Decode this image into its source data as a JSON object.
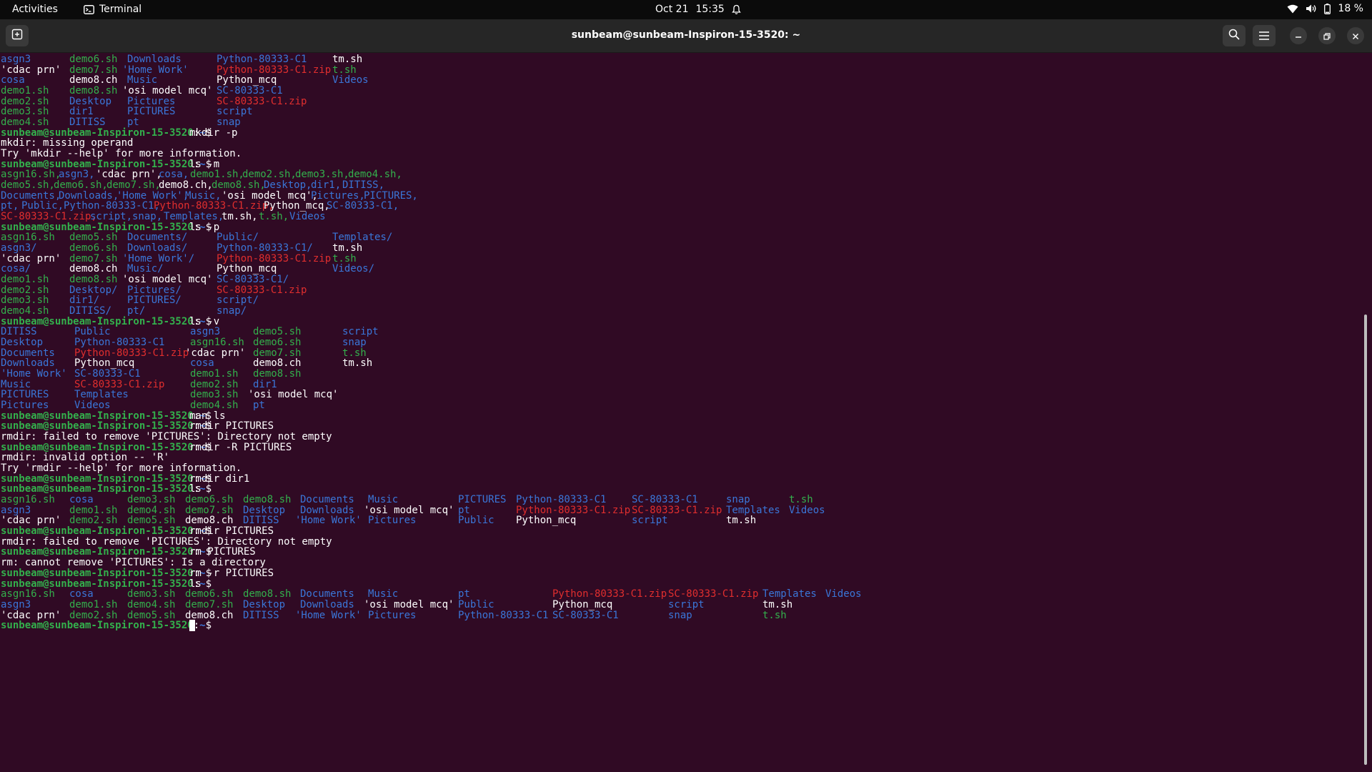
{
  "topbar": {
    "activities": "Activities",
    "app_name": "Terminal",
    "date": "Oct 21",
    "time": "15:35",
    "battery": "18 %"
  },
  "window": {
    "title": "sunbeam@sunbeam-Inspiron-15-3520: ~"
  },
  "colors": {
    "terminal_bg": "#300a24",
    "prompt_user": "#33b04c",
    "prompt_path": "#3a76d8",
    "directory": "#3a76d8",
    "executable": "#33b04c",
    "archive": "#e02e2e",
    "text": "#ffffff"
  },
  "icons": [
    "terminal-icon",
    "bell-icon",
    "wifi-icon",
    "volume-icon",
    "battery-icon",
    "new-tab-icon",
    "search-icon",
    "menu-icon",
    "minimize-icon",
    "restore-icon",
    "close-icon"
  ],
  "prompt": {
    "user_host": "sunbeam@sunbeam-Inspiron-15-3520",
    "sep": ":",
    "path": "~",
    "sym": "$ "
  },
  "terminal_lines": [
    [
      [
        "asgn3",
        0,
        "b"
      ],
      [
        "demo6.sh",
        96,
        "g"
      ],
      [
        "Downloads",
        177,
        "b"
      ],
      [
        "Python-80333-C1",
        302,
        "b"
      ],
      [
        "tm.sh",
        464,
        "w"
      ]
    ],
    [
      [
        "'cdac prn'",
        0,
        "w"
      ],
      [
        "demo7.sh",
        96,
        "g"
      ],
      [
        "'Home Work'",
        170,
        "b"
      ],
      [
        "Python-80333-C1.zip",
        302,
        "r"
      ],
      [
        "t.sh",
        464,
        "g"
      ]
    ],
    [
      [
        "cosa",
        0,
        "b"
      ],
      [
        "demo8.ch",
        96,
        "w"
      ],
      [
        "Music",
        177,
        "b"
      ],
      [
        "Python_mcq",
        302,
        "w"
      ],
      [
        "Videos",
        464,
        "b"
      ]
    ],
    [
      [
        "demo1.sh",
        0,
        "g"
      ],
      [
        "demo8.sh",
        96,
        "g"
      ],
      [
        "'osi model mcq'",
        170,
        "w"
      ],
      [
        "SC-80333-C1",
        302,
        "b"
      ]
    ],
    [
      [
        "demo2.sh",
        0,
        "g"
      ],
      [
        "Desktop",
        96,
        "b"
      ],
      [
        "Pictures",
        177,
        "b"
      ],
      [
        "SC-80333-C1.zip",
        302,
        "r"
      ]
    ],
    [
      [
        "demo3.sh",
        0,
        "g"
      ],
      [
        "dir1",
        96,
        "b"
      ],
      [
        "PICTURES",
        177,
        "b"
      ],
      [
        "script",
        302,
        "b"
      ]
    ],
    [
      [
        "demo4.sh",
        0,
        "g"
      ],
      [
        "DITISS",
        96,
        "b"
      ],
      [
        "pt",
        177,
        "b"
      ],
      [
        "snap",
        302,
        "b"
      ]
    ],
    [
      [
        "$P",
        0,
        "w"
      ],
      [
        "mkdir -p",
        264,
        "w"
      ]
    ],
    [
      [
        "mkdir: missing operand",
        0,
        "w"
      ]
    ],
    [
      [
        "Try 'mkdir --help' for more information.",
        0,
        "w"
      ]
    ],
    [
      [
        "$P",
        0,
        "w"
      ],
      [
        "ls -m",
        264,
        "w"
      ]
    ],
    [
      [
        "asgn16.sh,",
        0,
        "g"
      ],
      [
        "asgn3,",
        81,
        "b"
      ],
      [
        "'cdac prn',",
        133,
        "w"
      ],
      [
        "cosa,",
        221,
        "b"
      ],
      [
        "demo1.sh,",
        265,
        "g"
      ],
      [
        "demo2.sh,",
        338,
        "g"
      ],
      [
        "demo3.sh,",
        412,
        "g"
      ],
      [
        "demo4.sh,",
        486,
        "g"
      ]
    ],
    [
      [
        "demo5.sh,",
        0,
        "g"
      ],
      [
        "demo6.sh,",
        74,
        "g"
      ],
      [
        "demo7.sh,",
        148,
        "g"
      ],
      [
        "demo8.ch,",
        221,
        "w"
      ],
      [
        "demo8.sh,",
        295,
        "g"
      ],
      [
        "Desktop,",
        368,
        "b"
      ],
      [
        "dir1,",
        434,
        "b"
      ],
      [
        "DITISS,",
        478,
        "b"
      ]
    ],
    [
      [
        "Documents,",
        0,
        "b"
      ],
      [
        "Downloads,",
        81,
        "b"
      ],
      [
        "'Home Work',",
        162,
        "b"
      ],
      [
        "Music,",
        258,
        "b"
      ],
      [
        "'osi model mcq',",
        309,
        "w"
      ],
      [
        "Pictures,",
        434,
        "b"
      ],
      [
        "PICTURES,",
        508,
        "b"
      ]
    ],
    [
      [
        "pt,",
        0,
        "b"
      ],
      [
        "Public,",
        29,
        "b"
      ],
      [
        "Python-80333-C1,",
        88,
        "b"
      ],
      [
        "Python-80333-C1.zip,",
        214,
        "r"
      ],
      [
        "Python_mcq,",
        368,
        "w"
      ],
      [
        "SC-80333-C1,",
        456,
        "b"
      ]
    ],
    [
      [
        "SC-80333-C1.zip,",
        0,
        "r"
      ],
      [
        "script,",
        125,
        "b"
      ],
      [
        "snap,",
        184,
        "b"
      ],
      [
        "Templates,",
        228,
        "b"
      ],
      [
        "tm.sh,",
        309,
        "w"
      ],
      [
        "t.sh,",
        361,
        "g"
      ],
      [
        "Videos",
        404,
        "b"
      ]
    ],
    [
      [
        "$P",
        0,
        "w"
      ],
      [
        "ls -p",
        264,
        "w"
      ]
    ],
    [
      [
        "asgn16.sh",
        0,
        "g"
      ],
      [
        "demo5.sh",
        96,
        "g"
      ],
      [
        "Documents/",
        177,
        "b"
      ],
      [
        "Public/",
        302,
        "b"
      ],
      [
        "Templates/",
        464,
        "b"
      ]
    ],
    [
      [
        "asgn3/",
        0,
        "b"
      ],
      [
        "demo6.sh",
        96,
        "g"
      ],
      [
        "Downloads/",
        177,
        "b"
      ],
      [
        "Python-80333-C1/",
        302,
        "b"
      ],
      [
        "tm.sh",
        464,
        "w"
      ]
    ],
    [
      [
        "'cdac prn'",
        0,
        "w"
      ],
      [
        "demo7.sh",
        96,
        "g"
      ],
      [
        "'Home Work'/",
        170,
        "b"
      ],
      [
        "Python-80333-C1.zip",
        302,
        "r"
      ],
      [
        "t.sh",
        464,
        "g"
      ]
    ],
    [
      [
        "cosa/",
        0,
        "b"
      ],
      [
        "demo8.ch",
        96,
        "w"
      ],
      [
        "Music/",
        177,
        "b"
      ],
      [
        "Python_mcq",
        302,
        "w"
      ],
      [
        "Videos/",
        464,
        "b"
      ]
    ],
    [
      [
        "demo1.sh",
        0,
        "g"
      ],
      [
        "demo8.sh",
        96,
        "g"
      ],
      [
        "'osi model mcq'",
        170,
        "w"
      ],
      [
        "SC-80333-C1/",
        302,
        "b"
      ]
    ],
    [
      [
        "demo2.sh",
        0,
        "g"
      ],
      [
        "Desktop/",
        96,
        "b"
      ],
      [
        "Pictures/",
        177,
        "b"
      ],
      [
        "SC-80333-C1.zip",
        302,
        "r"
      ]
    ],
    [
      [
        "demo3.sh",
        0,
        "g"
      ],
      [
        "dir1/",
        96,
        "b"
      ],
      [
        "PICTURES/",
        177,
        "b"
      ],
      [
        "script/",
        302,
        "b"
      ]
    ],
    [
      [
        "demo4.sh",
        0,
        "g"
      ],
      [
        "DITISS/",
        96,
        "b"
      ],
      [
        "pt/",
        177,
        "b"
      ],
      [
        "snap/",
        302,
        "b"
      ]
    ],
    [
      [
        "$P",
        0,
        "w"
      ],
      [
        "ls -v",
        264,
        "w"
      ]
    ],
    [
      [
        "DITISS",
        0,
        "b"
      ],
      [
        "Public",
        103,
        "b"
      ],
      [
        "asgn3",
        265,
        "b"
      ],
      [
        "demo5.sh",
        353,
        "g"
      ],
      [
        "script",
        478,
        "b"
      ]
    ],
    [
      [
        "Desktop",
        0,
        "b"
      ],
      [
        "Python-80333-C1",
        103,
        "b"
      ],
      [
        "asgn16.sh",
        265,
        "g"
      ],
      [
        "demo6.sh",
        353,
        "g"
      ],
      [
        "snap",
        478,
        "b"
      ]
    ],
    [
      [
        "Documents",
        0,
        "b"
      ],
      [
        "Python-80333-C1.zip",
        103,
        "r"
      ],
      [
        "'cdac prn'",
        258,
        "w"
      ],
      [
        "demo7.sh",
        353,
        "g"
      ],
      [
        "t.sh",
        478,
        "g"
      ]
    ],
    [
      [
        "Downloads",
        0,
        "b"
      ],
      [
        "Python_mcq",
        103,
        "w"
      ],
      [
        "cosa",
        265,
        "b"
      ],
      [
        "demo8.ch",
        353,
        "w"
      ],
      [
        "tm.sh",
        478,
        "w"
      ]
    ],
    [
      [
        "'Home Work'",
        0,
        "b"
      ],
      [
        "SC-80333-C1",
        103,
        "b"
      ],
      [
        "demo1.sh",
        265,
        "g"
      ],
      [
        "demo8.sh",
        353,
        "g"
      ]
    ],
    [
      [
        "Music",
        0,
        "b"
      ],
      [
        "SC-80333-C1.zip",
        103,
        "r"
      ],
      [
        "demo2.sh",
        265,
        "g"
      ],
      [
        "dir1",
        353,
        "b"
      ]
    ],
    [
      [
        "PICTURES",
        0,
        "b"
      ],
      [
        "Templates",
        103,
        "b"
      ],
      [
        "demo3.sh",
        265,
        "g"
      ],
      [
        "'osi model mcq'",
        346,
        "w"
      ]
    ],
    [
      [
        "Pictures",
        0,
        "b"
      ],
      [
        "Videos",
        103,
        "b"
      ],
      [
        "demo4.sh",
        265,
        "g"
      ],
      [
        "pt",
        353,
        "b"
      ]
    ],
    [
      [
        "$P",
        0,
        "w"
      ],
      [
        "man ls",
        264,
        "w"
      ]
    ],
    [
      [
        "$P",
        0,
        "w"
      ],
      [
        "rmdir PICTURES",
        264,
        "w"
      ]
    ],
    [
      [
        "rmdir: failed to remove 'PICTURES': Directory not empty",
        0,
        "w"
      ]
    ],
    [
      [
        "$P",
        0,
        "w"
      ],
      [
        "rmdir -R PICTURES",
        264,
        "w"
      ]
    ],
    [
      [
        "rmdir: invalid option -- 'R'",
        0,
        "w"
      ]
    ],
    [
      [
        "Try 'rmdir --help' for more information.",
        0,
        "w"
      ]
    ],
    [
      [
        "$P",
        0,
        "w"
      ],
      [
        "rmdir dir1",
        264,
        "w"
      ]
    ],
    [
      [
        "$P",
        0,
        "w"
      ],
      [
        "ls",
        264,
        "w"
      ]
    ],
    [
      [
        "asgn16.sh",
        0,
        "g"
      ],
      [
        "cosa",
        96,
        "b"
      ],
      [
        "demo3.sh",
        177,
        "g"
      ],
      [
        "demo6.sh",
        258,
        "g"
      ],
      [
        "demo8.sh",
        339,
        "g"
      ],
      [
        "Documents",
        419,
        "b"
      ],
      [
        "Music",
        514,
        "b"
      ],
      [
        "PICTURES",
        640,
        "b"
      ],
      [
        "Python-80333-C1",
        721,
        "b"
      ],
      [
        "SC-80333-C1",
        883,
        "b"
      ],
      [
        "snap",
        1015,
        "b"
      ],
      [
        "t.sh",
        1103,
        "g"
      ]
    ],
    [
      [
        "asgn3",
        0,
        "b"
      ],
      [
        "demo1.sh",
        96,
        "g"
      ],
      [
        "demo4.sh",
        177,
        "g"
      ],
      [
        "demo7.sh",
        258,
        "g"
      ],
      [
        "Desktop",
        339,
        "b"
      ],
      [
        "Downloads",
        419,
        "b"
      ],
      [
        "'osi model mcq'",
        508,
        "w"
      ],
      [
        "pt",
        640,
        "b"
      ],
      [
        "Python-80333-C1.zip",
        721,
        "r"
      ],
      [
        "SC-80333-C1.zip",
        883,
        "r"
      ],
      [
        "Templates",
        1015,
        "b"
      ],
      [
        "Videos",
        1103,
        "b"
      ]
    ],
    [
      [
        "'cdac prn'",
        0,
        "w"
      ],
      [
        "demo2.sh",
        96,
        "g"
      ],
      [
        "demo5.sh",
        177,
        "g"
      ],
      [
        "demo8.ch",
        258,
        "w"
      ],
      [
        "DITISS",
        339,
        "b"
      ],
      [
        "'Home Work'",
        412,
        "b"
      ],
      [
        "Pictures",
        514,
        "b"
      ],
      [
        "Public",
        640,
        "b"
      ],
      [
        "Python_mcq",
        721,
        "w"
      ],
      [
        "script",
        883,
        "b"
      ],
      [
        "tm.sh",
        1015,
        "w"
      ]
    ],
    [
      [
        "$P",
        0,
        "w"
      ],
      [
        "rmdir PICTURES",
        264,
        "w"
      ]
    ],
    [
      [
        "rmdir: failed to remove 'PICTURES': Directory not empty",
        0,
        "w"
      ]
    ],
    [
      [
        "$P",
        0,
        "w"
      ],
      [
        "rm PICTURES",
        264,
        "w"
      ]
    ],
    [
      [
        "rm: cannot remove 'PICTURES': Is a directory",
        0,
        "w"
      ]
    ],
    [
      [
        "$P",
        0,
        "w"
      ],
      [
        "rm -r PICTURES",
        264,
        "w"
      ]
    ],
    [
      [
        "$P",
        0,
        "w"
      ],
      [
        "ls",
        264,
        "w"
      ]
    ],
    [
      [
        "asgn16.sh",
        0,
        "g"
      ],
      [
        "cosa",
        96,
        "b"
      ],
      [
        "demo3.sh",
        177,
        "g"
      ],
      [
        "demo6.sh",
        258,
        "g"
      ],
      [
        "demo8.sh",
        339,
        "g"
      ],
      [
        "Documents",
        419,
        "b"
      ],
      [
        "Music",
        514,
        "b"
      ],
      [
        "pt",
        640,
        "b"
      ],
      [
        "Python-80333-C1.zip",
        772,
        "r"
      ],
      [
        "SC-80333-C1.zip",
        934,
        "r"
      ],
      [
        "Templates",
        1066,
        "b"
      ],
      [
        "Videos",
        1154,
        "b"
      ]
    ],
    [
      [
        "asgn3",
        0,
        "b"
      ],
      [
        "demo1.sh",
        96,
        "g"
      ],
      [
        "demo4.sh",
        177,
        "g"
      ],
      [
        "demo7.sh",
        258,
        "g"
      ],
      [
        "Desktop",
        339,
        "b"
      ],
      [
        "Downloads",
        419,
        "b"
      ],
      [
        "'osi model mcq'",
        508,
        "w"
      ],
      [
        "Public",
        640,
        "b"
      ],
      [
        "Python_mcq",
        772,
        "w"
      ],
      [
        "script",
        934,
        "b"
      ],
      [
        "tm.sh",
        1066,
        "w"
      ]
    ],
    [
      [
        "'cdac prn'",
        0,
        "w"
      ],
      [
        "demo2.sh",
        96,
        "g"
      ],
      [
        "demo5.sh",
        177,
        "g"
      ],
      [
        "demo8.ch",
        258,
        "w"
      ],
      [
        "DITISS",
        339,
        "b"
      ],
      [
        "'Home Work'",
        412,
        "b"
      ],
      [
        "Pictures",
        514,
        "b"
      ],
      [
        "Python-80333-C1",
        640,
        "b"
      ],
      [
        "SC-80333-C1",
        772,
        "b"
      ],
      [
        "snap",
        934,
        "b"
      ],
      [
        "t.sh",
        1066,
        "g"
      ]
    ],
    [
      [
        "$P",
        0,
        "w"
      ],
      [
        "$CURSOR",
        264,
        "w"
      ]
    ]
  ]
}
